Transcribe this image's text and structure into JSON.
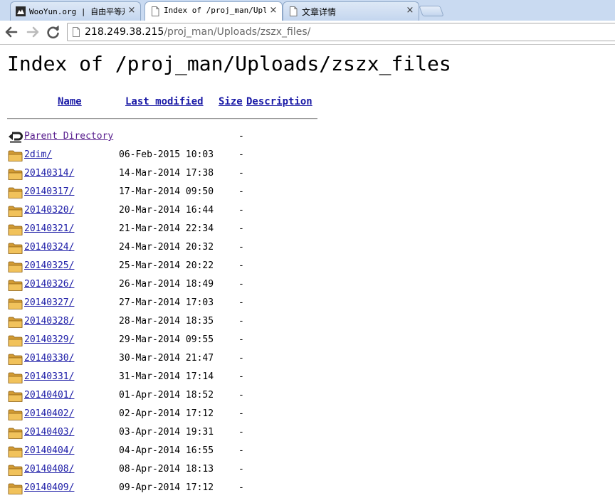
{
  "browser": {
    "tabs": [
      {
        "title": "WooYun.org | 自由平等开",
        "active": false
      },
      {
        "title": "Index of /proj_man/Uplo",
        "active": true
      },
      {
        "title": "文章详情",
        "active": false
      }
    ],
    "close_glyph": "×",
    "address": {
      "host": "218.249.38.215",
      "path": "/proj_man/Uploads/zszx_files/"
    }
  },
  "page": {
    "heading": "Index of /proj_man/Uploads/zszx_files",
    "columns": {
      "name": "Name",
      "last_modified": "Last modified",
      "size": "Size",
      "description": "Description"
    },
    "parent": {
      "name": "Parent Directory",
      "size": "-"
    },
    "entries": [
      {
        "name": "2dim/",
        "modified": "06-Feb-2015 10:03",
        "size": "-"
      },
      {
        "name": "20140314/",
        "modified": "14-Mar-2014 17:38",
        "size": "-"
      },
      {
        "name": "20140317/",
        "modified": "17-Mar-2014 09:50",
        "size": "-"
      },
      {
        "name": "20140320/",
        "modified": "20-Mar-2014 16:44",
        "size": "-"
      },
      {
        "name": "20140321/",
        "modified": "21-Mar-2014 22:34",
        "size": "-"
      },
      {
        "name": "20140324/",
        "modified": "24-Mar-2014 20:32",
        "size": "-"
      },
      {
        "name": "20140325/",
        "modified": "25-Mar-2014 20:22",
        "size": "-"
      },
      {
        "name": "20140326/",
        "modified": "26-Mar-2014 18:49",
        "size": "-"
      },
      {
        "name": "20140327/",
        "modified": "27-Mar-2014 17:03",
        "size": "-"
      },
      {
        "name": "20140328/",
        "modified": "28-Mar-2014 18:35",
        "size": "-"
      },
      {
        "name": "20140329/",
        "modified": "29-Mar-2014 09:55",
        "size": "-"
      },
      {
        "name": "20140330/",
        "modified": "30-Mar-2014 21:47",
        "size": "-"
      },
      {
        "name": "20140331/",
        "modified": "31-Mar-2014 17:14",
        "size": "-"
      },
      {
        "name": "20140401/",
        "modified": "01-Apr-2014 18:52",
        "size": "-"
      },
      {
        "name": "20140402/",
        "modified": "02-Apr-2014 17:12",
        "size": "-"
      },
      {
        "name": "20140403/",
        "modified": "03-Apr-2014 19:31",
        "size": "-"
      },
      {
        "name": "20140404/",
        "modified": "04-Apr-2014 16:55",
        "size": "-"
      },
      {
        "name": "20140408/",
        "modified": "08-Apr-2014 18:13",
        "size": "-"
      },
      {
        "name": "20140409/",
        "modified": "09-Apr-2014 17:12",
        "size": "-"
      }
    ]
  },
  "colors": {
    "link": "#1a1aa6",
    "visited_link": "#551a8b",
    "tab_strip": "#c9daf1",
    "folder": "#e8b94c"
  },
  "icons": {
    "tab_1": "wooyun-favicon-icon",
    "tab_2": "page-icon",
    "tab_3": "page-icon",
    "back": "back-arrow-icon",
    "forward": "forward-arrow-icon",
    "reload": "reload-icon",
    "parent": "back-arrow-folder-icon",
    "entry": "folder-icon"
  }
}
